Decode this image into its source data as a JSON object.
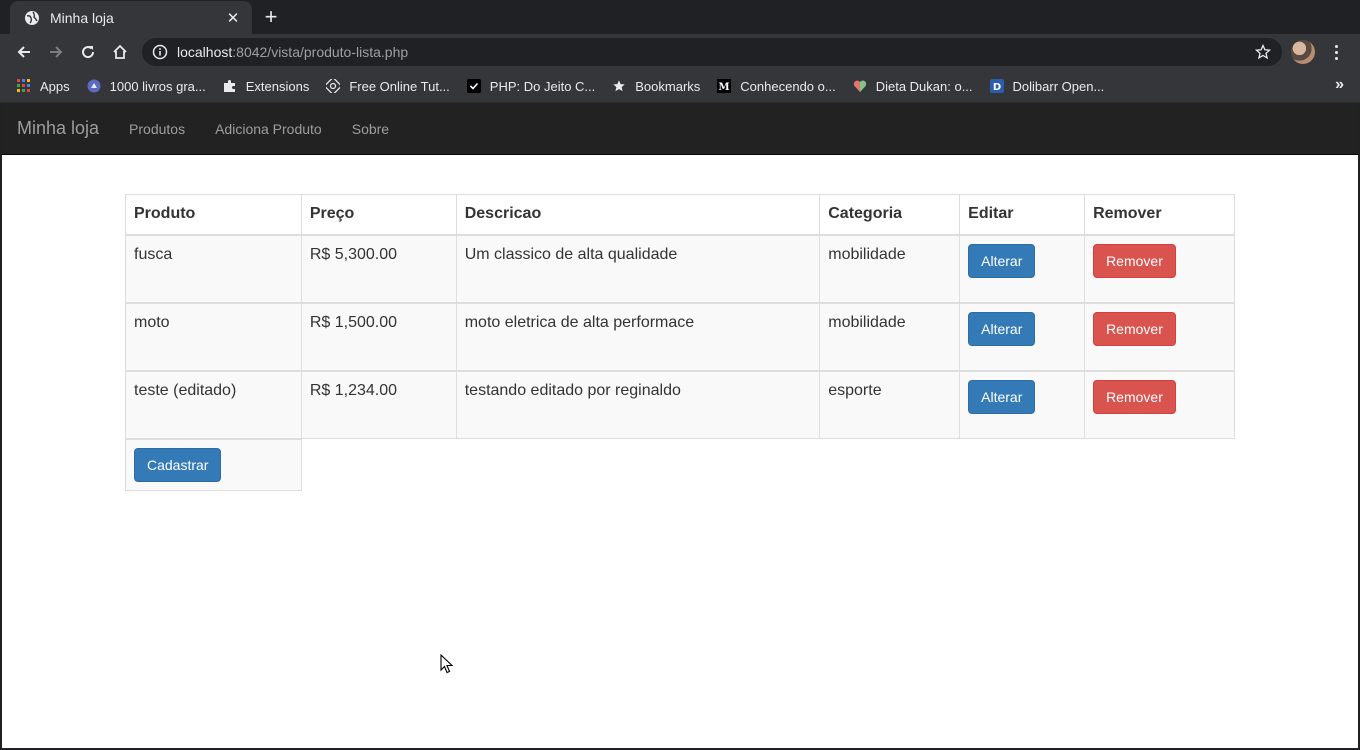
{
  "browser": {
    "tab_title": "Minha loja",
    "url_host": "localhost",
    "url_rest": ":8042/vista/produto-lista.php",
    "bookmarks": [
      {
        "label": "Apps",
        "icon": "apps-grid-icon"
      },
      {
        "label": "1000 livros gra...",
        "icon": "book-site-icon"
      },
      {
        "label": "Extensions",
        "icon": "puzzle-icon"
      },
      {
        "label": "Free Online Tut...",
        "icon": "tutorial-site-icon"
      },
      {
        "label": "PHP: Do Jeito C...",
        "icon": "checkmark-site-icon"
      },
      {
        "label": "Bookmarks",
        "icon": "star-icon"
      },
      {
        "label": "Conhecendo o...",
        "icon": "medium-logo-icon"
      },
      {
        "label": "Dieta Dukan: o...",
        "icon": "heart-site-icon"
      },
      {
        "label": "Dolibarr Open...",
        "icon": "dolibarr-logo-icon"
      }
    ],
    "more_bookmarks": "»"
  },
  "site": {
    "brand": "Minha loja",
    "nav": [
      "Produtos",
      "Adiciona Produto",
      "Sobre"
    ]
  },
  "table": {
    "headers": [
      "Produto",
      "Preço",
      "Descricao",
      "Categoria",
      "Editar",
      "Remover"
    ],
    "rows": [
      {
        "produto": "fusca",
        "preco": "R$ 5,300.00",
        "descricao": "Um classico de alta qualidade",
        "categoria": "mobilidade",
        "editar": "Alterar",
        "remover": "Remover"
      },
      {
        "produto": "moto",
        "preco": "R$ 1,500.00",
        "descricao": "moto eletrica de alta performace",
        "categoria": "mobilidade",
        "editar": "Alterar",
        "remover": "Remover"
      },
      {
        "produto": "teste (editado)",
        "preco": "R$ 1,234.00",
        "descricao": "testando editado por reginaldo",
        "categoria": "esporte",
        "editar": "Alterar",
        "remover": "Remover"
      }
    ],
    "cadastrar_label": "Cadastrar"
  },
  "colors": {
    "primary": "#337ab7",
    "danger": "#d9534f",
    "navbar": "#222222",
    "chrome_dark": "#202124",
    "chrome_toolbar": "#35363a"
  }
}
